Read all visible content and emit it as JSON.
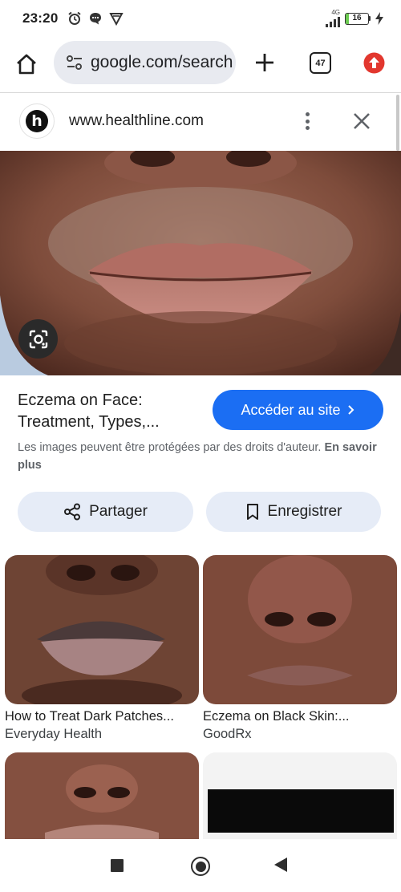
{
  "status_bar": {
    "time": "23:20",
    "network": "4G",
    "battery_level": "16",
    "battery_fraction": 0.16
  },
  "toolbar": {
    "url": "google.com/search",
    "tab_count": "47"
  },
  "site": {
    "favicon_letter": "h",
    "url": "www.healthline.com"
  },
  "result": {
    "title_line1": "Eczema on Face:",
    "title_line2": "Treatment, Types,...",
    "visit_label": "Accéder au site",
    "copyright_text": "Les images peuvent être protégées par des droits d'auteur.",
    "learn_more": "En savoir plus"
  },
  "actions": {
    "share_label": "Partager",
    "save_label": "Enregistrer"
  },
  "related": [
    {
      "title": "How to Treat Dark Patches...",
      "source": "Everyday Health"
    },
    {
      "title": "Eczema on Black Skin:...",
      "source": "GoodRx"
    }
  ],
  "colors": {
    "accent": "#1b6ef3",
    "pill_background": "#e6ecf7",
    "url_bar_background": "#e8eaf0",
    "update_badge": "#e2372e"
  },
  "icons": {
    "home": "home-icon",
    "tune": "tune-icon",
    "new_tab": "plus-icon",
    "update": "arrow-up-icon",
    "lens": "lens-icon",
    "share": "share-icon",
    "save": "bookmark-icon"
  }
}
